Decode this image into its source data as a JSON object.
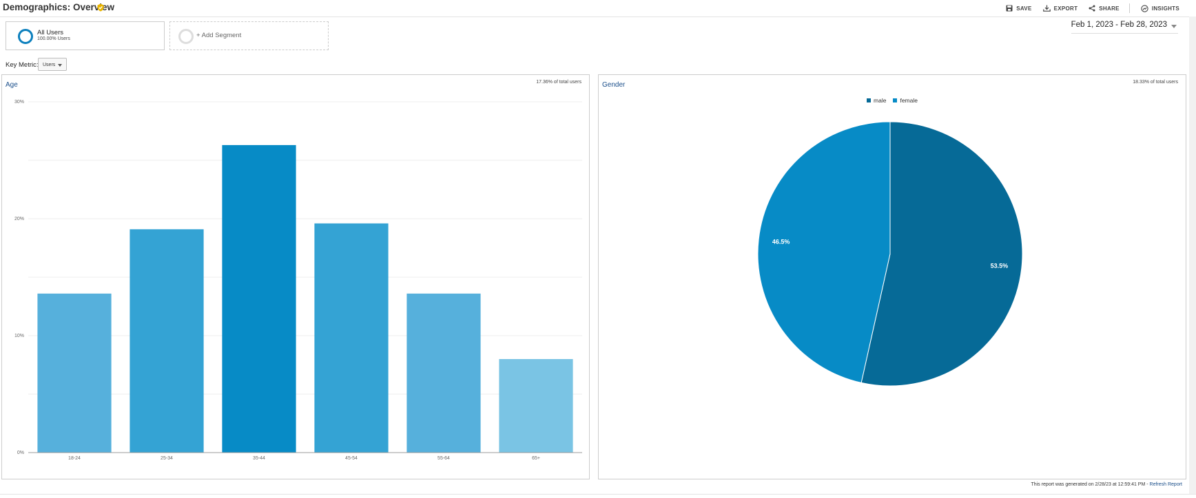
{
  "header": {
    "title": "Demographics: Overview",
    "tools": [
      "SAVE",
      "EXPORT",
      "SHARE",
      "INSIGHTS"
    ]
  },
  "segments": {
    "active": {
      "name": "All Users",
      "sub": "100.00% Users"
    },
    "add_label": "+ Add Segment"
  },
  "date_range": "Feb 1, 2023 - Feb 28, 2023",
  "key_metric": {
    "label": "Key Metric:",
    "value": "Users"
  },
  "age_panel": {
    "title": "Age",
    "note": "17.36% of total users"
  },
  "gender_panel": {
    "title": "Gender",
    "note": "18.33% of total users"
  },
  "footer": {
    "text": "This report was generated on 2/28/23 at 12:59:41 PM - ",
    "link": "Refresh Report"
  },
  "colors": {
    "brand": "#0b7fbd",
    "male": "#066a97",
    "female": "#078bc6"
  },
  "chart_data": [
    {
      "type": "bar",
      "categories": [
        "18-24",
        "25-34",
        "35-44",
        "45-54",
        "55-64",
        "65+"
      ],
      "values": [
        13.6,
        19.1,
        26.3,
        19.6,
        13.6,
        8.0
      ],
      "colors": [
        "#56b0dc",
        "#34a3d4",
        "#078bc6",
        "#34a3d4",
        "#56b0dc",
        "#7ac4e4"
      ],
      "ylim": [
        0,
        30
      ],
      "yticks": [
        "0%",
        "10%",
        "20%",
        "30%"
      ],
      "grid": true
    },
    {
      "type": "pie",
      "labels": [
        "male",
        "female"
      ],
      "values": [
        53.5,
        46.5
      ],
      "data_labels": [
        "53.5%",
        "46.5%"
      ],
      "colors": [
        "#066a97",
        "#078bc6"
      ],
      "legend": "top"
    }
  ]
}
